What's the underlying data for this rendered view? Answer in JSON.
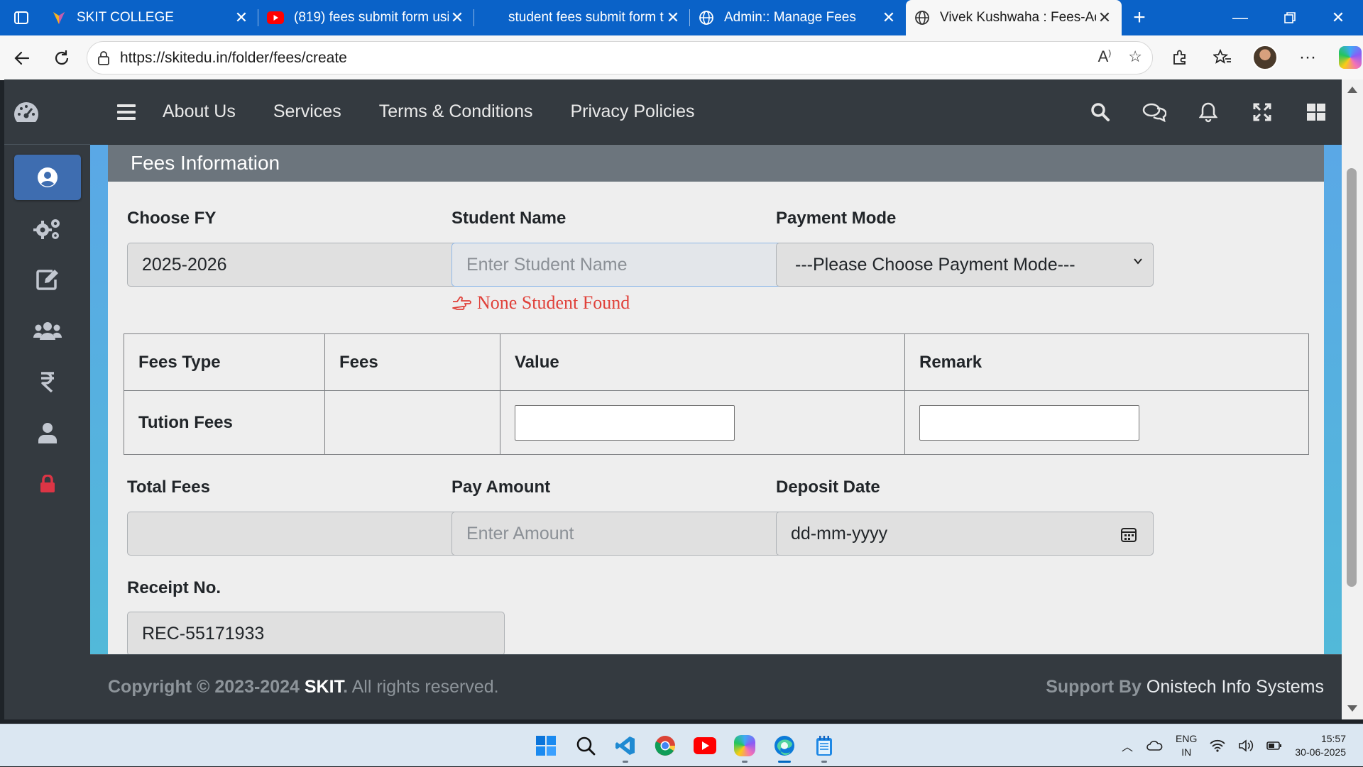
{
  "browser": {
    "tabs": [
      {
        "title": "SKIT COLLEGE",
        "icon": "skit-favicon",
        "active": false
      },
      {
        "title": "(819) fees submit form usir",
        "icon": "youtube-favicon",
        "active": false
      },
      {
        "title": "student fees submit form t",
        "icon": "blank-favicon",
        "active": false
      },
      {
        "title": "Admin:: Manage Fees",
        "icon": "globe-favicon",
        "active": false
      },
      {
        "title": "Vivek Kushwaha : Fees-Adc",
        "icon": "globe-favicon",
        "active": true
      }
    ],
    "url": "https://skitedu.in/folder/fees/create"
  },
  "topnav": {
    "links": [
      "About Us",
      "Services",
      "Terms & Conditions",
      "Privacy Policies"
    ]
  },
  "sidebar": {
    "items": [
      {
        "icon": "user-circle-icon",
        "active": true
      },
      {
        "icon": "gears-icon",
        "active": false
      },
      {
        "icon": "edit-icon",
        "active": false
      },
      {
        "icon": "users-icon",
        "active": false
      },
      {
        "icon": "rupee-icon",
        "active": false
      },
      {
        "icon": "user-icon",
        "active": false
      },
      {
        "icon": "lock-icon",
        "active": false
      }
    ]
  },
  "form": {
    "heading": "Fees Information",
    "fy_label": "Choose FY",
    "fy_value": "2025-2026",
    "student_label": "Student Name",
    "student_placeholder": "Enter Student Name",
    "student_error": "None Student Found",
    "payment_label": "Payment Mode",
    "payment_value": "---Please Choose Payment Mode---",
    "table": {
      "headers": [
        "Fees Type",
        "Fees",
        "Value",
        "Remark"
      ],
      "rows": [
        {
          "type": "Tution Fees",
          "fees": "",
          "value": "",
          "remark": ""
        }
      ]
    },
    "total_label": "Total Fees",
    "total_value": "",
    "pay_label": "Pay Amount",
    "pay_placeholder": "Enter Amount",
    "date_label": "Deposit Date",
    "date_placeholder": "dd-mm-yyyy",
    "receipt_label": "Receipt No.",
    "receipt_value": "REC-55171933"
  },
  "footer": {
    "copyright_prefix": "Copyright © 2023-2024",
    "brand": "SKIT",
    "rights": "All rights reserved.",
    "support_prefix": "Support By",
    "support_name": "Onistech Info Systems"
  },
  "taskbar": {
    "lang_top": "ENG",
    "lang_bottom": "IN",
    "time": "15:57",
    "date": "30-06-2025"
  },
  "colors": {
    "accent": "#3e6db0",
    "error": "#e0413a",
    "browser_blue": "#0a62c8"
  }
}
